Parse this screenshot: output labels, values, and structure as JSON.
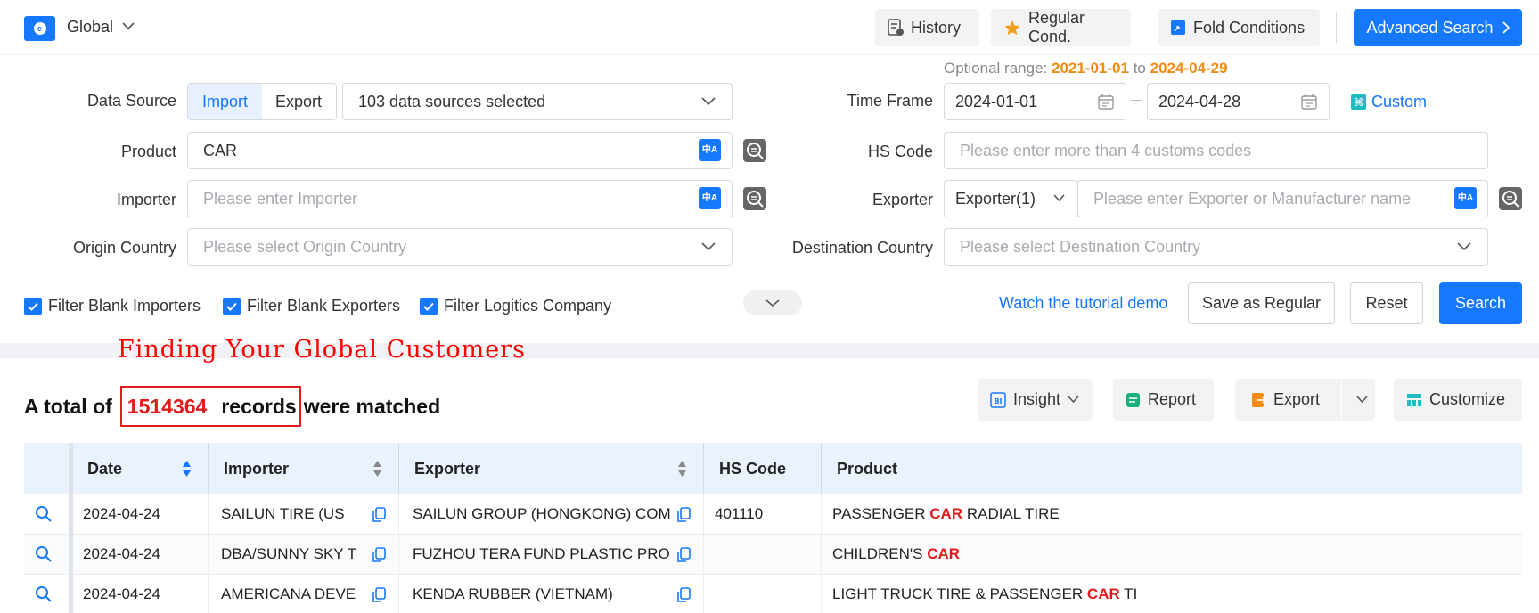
{
  "topbar": {
    "global_label": "Global",
    "history": "History",
    "regular_cond": "Regular Cond.",
    "fold_conditions": "Fold Conditions",
    "advanced_search": "Advanced Search"
  },
  "form": {
    "data_source_label": "Data Source",
    "import_label": "Import",
    "export_label": "Export",
    "data_sources_value": "103 data sources selected",
    "product_label": "Product",
    "product_value": "CAR",
    "importer_label": "Importer",
    "importer_placeholder": "Please enter Importer",
    "origin_label": "Origin Country",
    "origin_placeholder": "Please select Origin Country",
    "optional_prefix": "Optional range:",
    "optional_start": "2021-01-01",
    "optional_to": "to",
    "optional_end": "2024-04-29",
    "time_frame_label": "Time Frame",
    "date_from": "2024-01-01",
    "date_to": "2024-04-28",
    "custom_label": "Custom",
    "hs_code_label": "HS Code",
    "hs_code_placeholder": "Please enter more than 4 customs codes",
    "exporter_label": "Exporter",
    "exporter_select": "Exporter(1)",
    "exporter_placeholder": "Please enter Exporter or Manufacturer name",
    "destination_label": "Destination Country",
    "destination_placeholder": "Please select Destination Country"
  },
  "filters": {
    "blank_importers": "Filter Blank Importers",
    "blank_exporters": "Filter Blank Exporters",
    "logistics": "Filter Logitics Company"
  },
  "actions": {
    "watch_tutorial": "Watch the tutorial demo",
    "save_regular": "Save as Regular",
    "reset": "Reset",
    "search": "Search"
  },
  "overlay": {
    "title": "Finding Your Global Customers"
  },
  "results": {
    "prefix": "A total of",
    "count": "1514364",
    "records": "records",
    "suffix": "were matched",
    "insight": "Insight",
    "report": "Report",
    "export": "Export",
    "customize": "Customize"
  },
  "table": {
    "headers": {
      "date": "Date",
      "importer": "Importer",
      "exporter": "Exporter",
      "hs_code": "HS Code",
      "product": "Product"
    },
    "rows": [
      {
        "date": "2024-04-24",
        "importer": "SAILUN TIRE (US",
        "exporter": "SAILUN GROUP (HONGKONG) COM",
        "hs_code": "401110",
        "product_pre": "PASSENGER ",
        "product_hl": "CAR",
        "product_post": " RADIAL TIRE"
      },
      {
        "date": "2024-04-24",
        "importer": "DBA/SUNNY SKY T",
        "exporter": "FUZHOU TERA FUND PLASTIC PRO",
        "hs_code": "",
        "product_pre": "CHILDREN'S ",
        "product_hl": "CAR",
        "product_post": ""
      },
      {
        "date": "2024-04-24",
        "importer": "AMERICANA DEVE",
        "exporter": "KENDA RUBBER (VIETNAM)",
        "hs_code": "",
        "product_pre": "LIGHT TRUCK TIRE & PASSENGER ",
        "product_hl": "CAR",
        "product_post": " TI"
      }
    ]
  },
  "colors": {
    "primary": "#1677ff",
    "highlight_red": "#e01b1b",
    "optional_orange": "#f08c15"
  }
}
